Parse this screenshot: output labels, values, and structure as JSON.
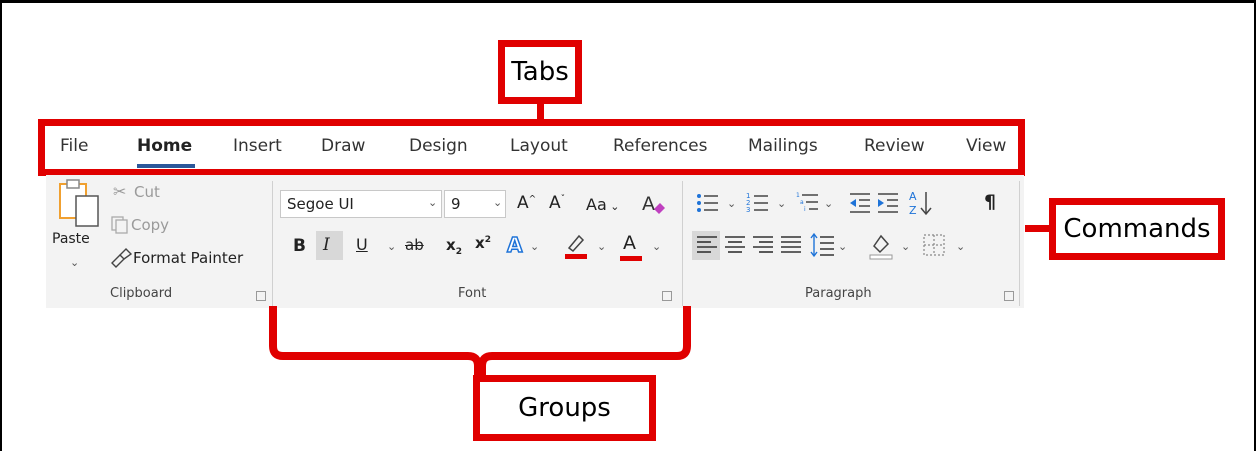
{
  "callouts": {
    "tabs": "Tabs",
    "commands": "Commands",
    "groups": "Groups"
  },
  "tabs": [
    "File",
    "Home",
    "Insert",
    "Draw",
    "Design",
    "Layout",
    "References",
    "Mailings",
    "Review",
    "View"
  ],
  "clipboard": {
    "paste": "Paste",
    "cut": "Cut",
    "copy": "Copy",
    "format_painter": "Format Painter",
    "label": "Clipboard"
  },
  "font": {
    "name": "Segoe UI",
    "size": "9",
    "change_case": "Aa",
    "label": "Font"
  },
  "paragraph": {
    "label": "Paragraph"
  },
  "colors": {
    "accent": "#2b579a",
    "callout": "#e00000",
    "blue_text": "#1e73d8"
  }
}
